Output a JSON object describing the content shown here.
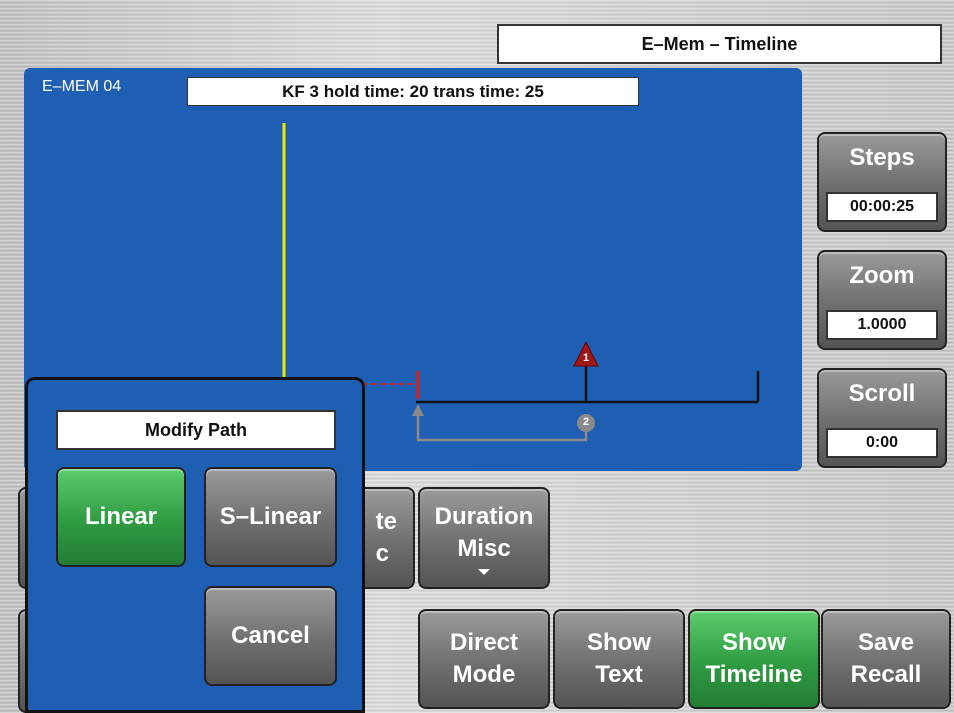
{
  "header": {
    "title": "E–Mem – Timeline"
  },
  "panel": {
    "name": "E–MEM 04",
    "info": "KF 3 hold time: 20 trans time: 25",
    "keyframes": [
      {
        "number": "1",
        "color": "#a01818"
      },
      {
        "number": "2",
        "color": "#8a8a8a"
      }
    ]
  },
  "side": {
    "steps": {
      "label": "Steps",
      "value": "00:00:25"
    },
    "zoom": {
      "label": "Zoom",
      "value": "1.0000"
    },
    "scroll": {
      "label": "Scroll",
      "value": "0:00"
    }
  },
  "buttons": {
    "delete_misc": {
      "line1": "te",
      "line2": "c"
    },
    "duration_misc": {
      "line1": "Duration",
      "line2": "Misc"
    },
    "direct_mode": {
      "line1": "Direct",
      "line2": "Mode"
    },
    "show_text": {
      "line1": "Show",
      "line2": "Text"
    },
    "show_timeline": {
      "line1": "Show",
      "line2": "Timeline"
    },
    "save_recall": {
      "line1": "Save",
      "line2": "Recall"
    }
  },
  "dialog": {
    "title": "Modify Path",
    "linear": "Linear",
    "s_linear": "S–Linear",
    "cancel": "Cancel"
  },
  "colors": {
    "panel_blue": "#1f5fb3",
    "accent_green": "#2f9b42",
    "cursor_yellow": "#e8e800"
  }
}
